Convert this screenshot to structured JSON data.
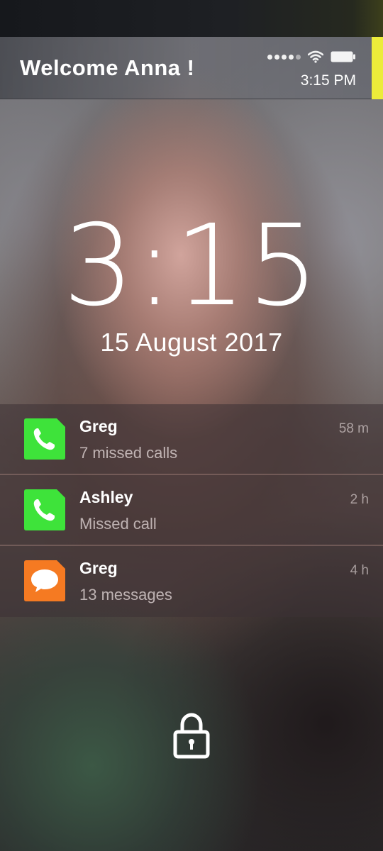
{
  "header": {
    "welcome": "Welcome Anna !",
    "time": "3:15 PM",
    "accent_color": "#ecec3a"
  },
  "status_icons": [
    "signal-dots-icon",
    "wifi-icon",
    "battery-icon"
  ],
  "lockscreen": {
    "clock": "3:15",
    "date": "15 August 2017"
  },
  "notifications": [
    {
      "app": "phone",
      "icon": "phone-icon",
      "title": "Greg",
      "body": "7 missed calls",
      "time": "58 m",
      "color": "#3ee33a"
    },
    {
      "app": "phone",
      "icon": "phone-icon",
      "title": "Ashley",
      "body": "Missed call",
      "time": "2 h",
      "color": "#3ee33a"
    },
    {
      "app": "messages",
      "icon": "message-bubble-icon",
      "title": "Greg",
      "body": "13 messages",
      "time": "4 h",
      "color": "#f57a22"
    }
  ],
  "lock_icon": "padlock-icon"
}
